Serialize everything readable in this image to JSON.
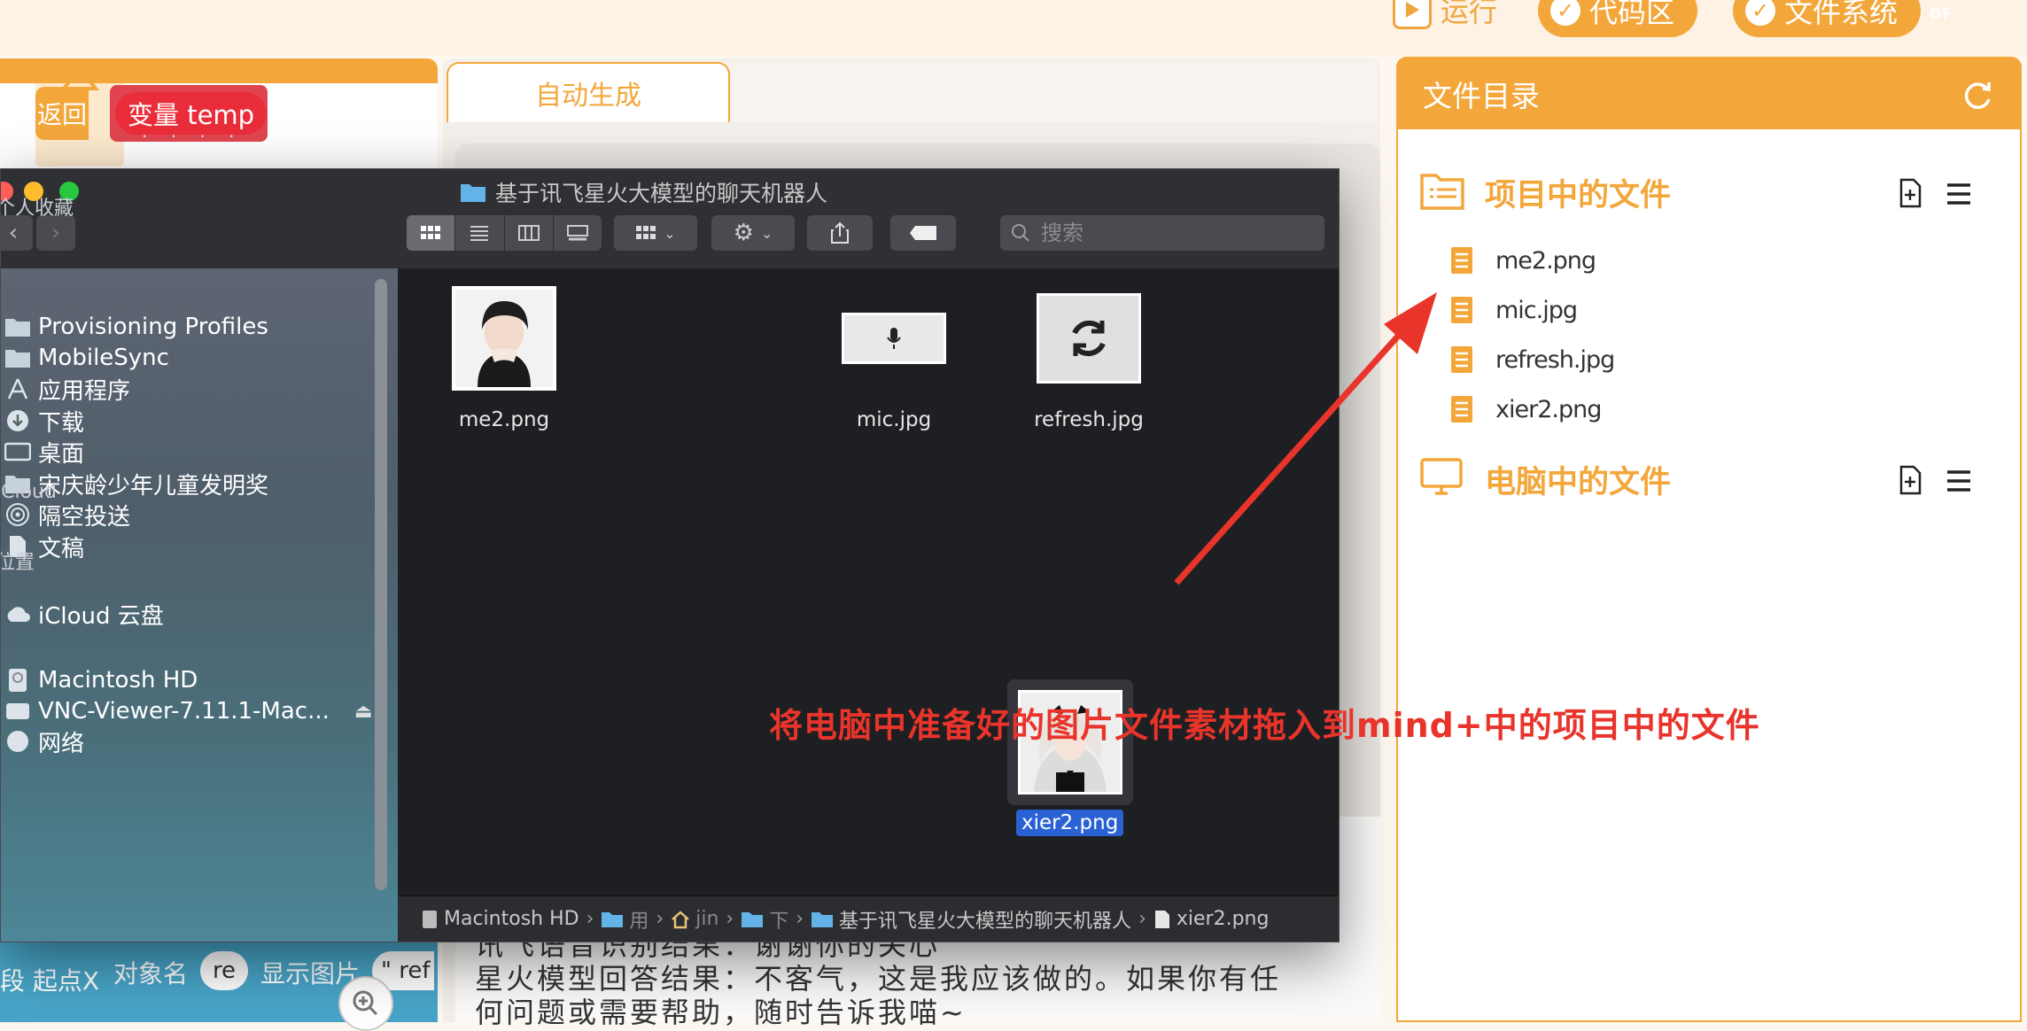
{
  "topbar": {
    "run_label": "运行",
    "code_label": "代码区",
    "fs_label": "文件系统",
    "logo": "DF"
  },
  "blocks": {
    "return_label": "返回",
    "var_label": "变量 temp",
    "lower_segment": "段 起点X",
    "lower_object_name": "对象名",
    "lower_re": "re",
    "lower_show_image": "显示图片",
    "lower_ref": "\" ref"
  },
  "middle": {
    "tab_label": "自动生成",
    "console_lines": [
      "讯飞语音识别结果：谢谢你的关心",
      "星火模型回答结果：不客气，这是我应该做的。如果你有任",
      "何问题或需要帮助，随时告诉我喵~"
    ]
  },
  "directory": {
    "title": "文件目录",
    "project_section": "项目中的文件",
    "project_files": [
      "me2.png",
      "mic.jpg",
      "refresh.jpg",
      "xier2.png"
    ],
    "pc_section": "电脑中的文件",
    "accent": "#f3a73b"
  },
  "finder": {
    "title": "基于讯飞星火大模型的聊天机器人",
    "search_placeholder": "搜索",
    "sidebar": {
      "favorites_header": "个人收藏",
      "favorites": [
        {
          "label": "Provisioning Profiles",
          "icon": "folder-icon"
        },
        {
          "label": "MobileSync",
          "icon": "folder-icon"
        },
        {
          "label": "应用程序",
          "icon": "applications-icon"
        },
        {
          "label": "下载",
          "icon": "download-icon"
        },
        {
          "label": "桌面",
          "icon": "desktop-icon"
        },
        {
          "label": "宋庆龄少年儿童发明奖",
          "icon": "folder-icon"
        },
        {
          "label": "隔空投送",
          "icon": "airdrop-icon"
        },
        {
          "label": "文稿",
          "icon": "document-icon"
        }
      ],
      "icloud_header": "iCloud",
      "icloud": [
        {
          "label": "iCloud 云盘",
          "icon": "cloud-icon"
        }
      ],
      "locations_header": "位置",
      "locations": [
        {
          "label": "Macintosh HD",
          "icon": "disk-icon"
        },
        {
          "label": "VNC-Viewer-7.11.1-Mac...",
          "icon": "disk-icon"
        },
        {
          "label": "网络",
          "icon": "network-icon"
        }
      ]
    },
    "files": [
      "me2.png",
      "mic.jpg",
      "refresh.jpg",
      "xier2.png"
    ],
    "selected_file": "xier2.png",
    "path": [
      "Macintosh HD",
      "用",
      "jin",
      "下",
      "基于讯飞星火大模型的聊天机器人",
      "xier2.png"
    ]
  },
  "annotation": "将电脑中准备好的图片文件素材拖入到mind+中的项目中的文件"
}
